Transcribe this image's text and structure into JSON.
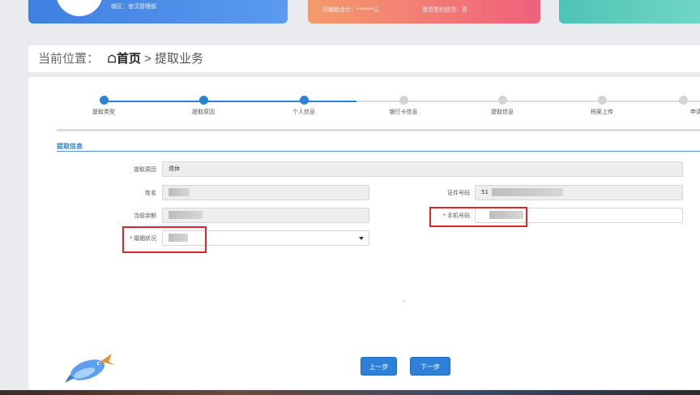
{
  "top_cards": {
    "blue_text": "辖区：官汉管理部",
    "red_text_1": "月缴款合计：******元",
    "red_text_2": "是否签约还贷：否"
  },
  "breadcrumb": {
    "prefix": "当前位置：",
    "home_icon": "home-icon",
    "home": "首页",
    "separator": " > ",
    "current": "提取业务"
  },
  "steps": [
    {
      "label": "提取类型",
      "status": "done"
    },
    {
      "label": "提取原因",
      "status": "done"
    },
    {
      "label": "个人信息",
      "status": "done"
    },
    {
      "label": "银行卡信息",
      "status": "todo"
    },
    {
      "label": "提取信息",
      "status": "todo"
    },
    {
      "label": "档案上传",
      "status": "todo"
    },
    {
      "label": "申请",
      "status": "todo"
    }
  ],
  "section": {
    "title": "提取信息"
  },
  "form": {
    "reason": {
      "label": "提取原因",
      "value": "退休"
    },
    "name": {
      "label": "姓名"
    },
    "id_number": {
      "label": "证件号码",
      "value": "51"
    },
    "balance": {
      "label": "当前余额"
    },
    "phone": {
      "label": "手机号码",
      "required_mark": "*"
    },
    "marital": {
      "label": "婚姻状况",
      "required_mark": "*"
    }
  },
  "buttons": {
    "prev": "上一步",
    "next": "下一步"
  },
  "colors": {
    "accent": "#2c83d6",
    "highlight_box": "#e0242a"
  }
}
